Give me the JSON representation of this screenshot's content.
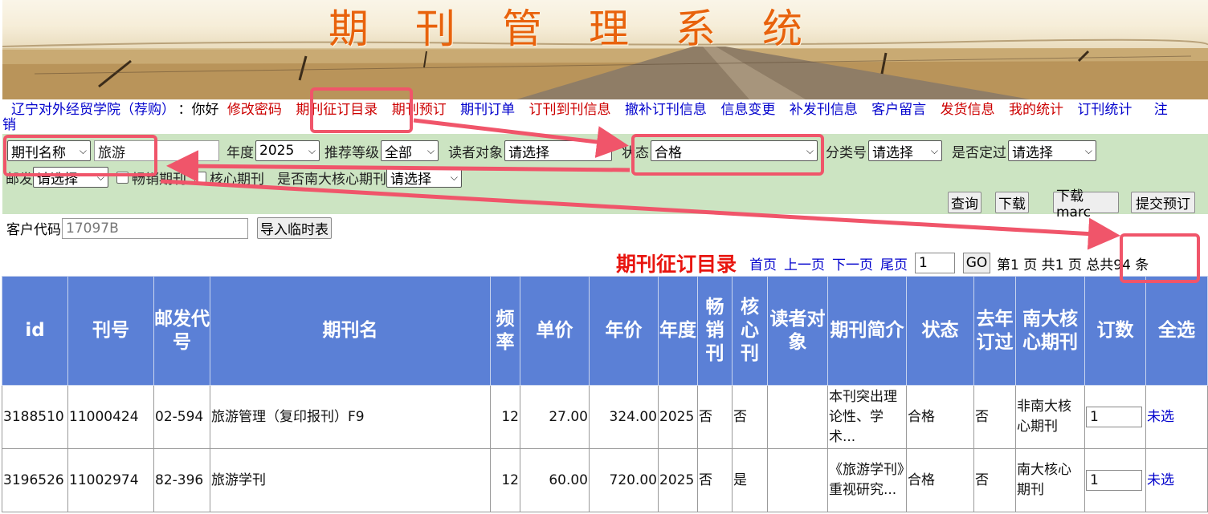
{
  "banner": {
    "title": "期刊管理系统"
  },
  "nav": {
    "school": "辽宁对外经贸学院（荐购）",
    "hello": "：你好",
    "links": [
      {
        "label": "修改密码",
        "color": "red"
      },
      {
        "label": "期刊征订目录",
        "color": "red"
      },
      {
        "label": "期刊预订",
        "color": "red"
      },
      {
        "label": "期刊订单",
        "color": "blue"
      },
      {
        "label": "订刊到刊信息",
        "color": "red"
      },
      {
        "label": "撤补订刊信息",
        "color": "blue"
      },
      {
        "label": "信息变更",
        "color": "blue"
      },
      {
        "label": "补发刊信息",
        "color": "blue"
      },
      {
        "label": "客户留言",
        "color": "blue"
      },
      {
        "label": "发货信息",
        "color": "red"
      },
      {
        "label": "我的统计",
        "color": "red"
      },
      {
        "label": "订刊统计",
        "color": "blue"
      }
    ],
    "logout_part1": "注",
    "logout_part2": "销"
  },
  "filters": {
    "field_select": "期刊名称",
    "keyword": "旅游",
    "year_label": "年度",
    "year_value": "2025",
    "rec_label": "推荐等级",
    "rec_value": "全部",
    "reader_label": "读者对象",
    "reader_value": "请选择",
    "status_label": "状态",
    "status_value": "合格",
    "class_label": "分类号",
    "class_value": "请选择",
    "fixed_label": "是否定过",
    "fixed_value": "请选择",
    "post_label": "邮发",
    "post_value": "请选择",
    "bestseller_label": "畅销期刊",
    "core_label": "核心期刊",
    "nju_label": "是否南大核心期刊",
    "nju_value": "请选择"
  },
  "actions": {
    "query": "查询",
    "download": "下载",
    "download_marc": "下载marc",
    "submit": "提交预订"
  },
  "client": {
    "label": "客户代码",
    "placeholder": "17097B",
    "import": "导入临时表"
  },
  "pager": {
    "title": "期刊征订目录",
    "first": "首页",
    "prev": "上一页",
    "next": "下一页",
    "last": "尾页",
    "page_input": "1",
    "go": "GO",
    "page_info": "第1 页 共1 页 总共94 条"
  },
  "table": {
    "headers": [
      "id",
      "刊号",
      "邮发代号",
      "期刊名",
      "频率",
      "单价",
      "年价",
      "年度",
      "畅销刊",
      "核心刊",
      "读者对象",
      "期刊简介",
      "状态",
      "去年订过",
      "南大核心期刊",
      "订数",
      "全选"
    ],
    "rows": [
      {
        "id": "3188510",
        "issn": "11000424",
        "post": "02-594",
        "name": "旅游管理（复印报刊）F9",
        "freq": "12",
        "price": "27.00",
        "year_price": "324.00",
        "year": "2025",
        "bestseller": "否",
        "core": "否",
        "reader": "",
        "intro": "本刊突出理论性、学术...",
        "status": "合格",
        "last_year": "否",
        "nju": "非南大核心期刊",
        "qty": "1",
        "pick": "未选"
      },
      {
        "id": "3196526",
        "issn": "11002974",
        "post": "82-396",
        "name": "旅游学刊",
        "freq": "12",
        "price": "60.00",
        "year_price": "720.00",
        "year": "2025",
        "bestseller": "否",
        "core": "是",
        "reader": "",
        "intro": "《旅游学刊》重视研究...",
        "status": "合格",
        "last_year": "否",
        "nju": "南大核心期刊",
        "qty": "1",
        "pick": "未选"
      }
    ]
  },
  "colors": {
    "header_bg": "#5b80d6",
    "filter_bg": "#cce4c2",
    "title_orange": "#e8620c",
    "pager_title": "#e8150f",
    "annotation": "#f0556a"
  }
}
